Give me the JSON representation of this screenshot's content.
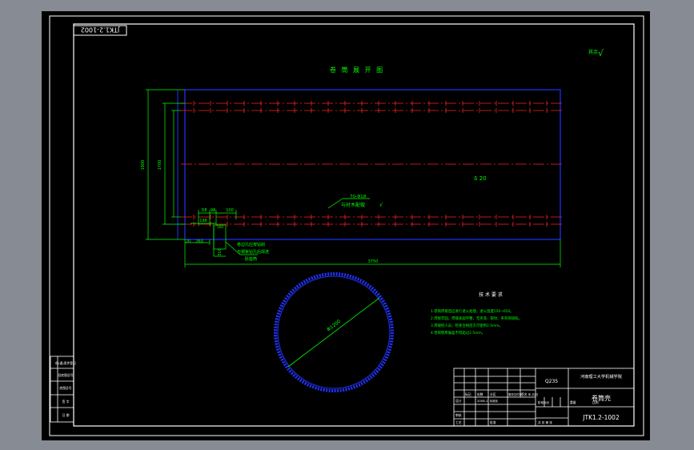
{
  "drawing": {
    "code_box": "JTK1.2-1002",
    "title": "卷 筒 展 开 图",
    "roughness": "其余",
    "roughness_symbol": "√"
  },
  "dimensions": {
    "total_height": "1900",
    "inner_height": "1700",
    "total_length": "3750",
    "offset_196": "196",
    "dim_d8": "D8",
    "dim_98": "98",
    "dim_100": "100",
    "dim_160": "160",
    "dim_260": "260",
    "dim_20": "20",
    "dim_310": "310",
    "thickness": "δ 20",
    "diameter": "Φ1200"
  },
  "annotations": {
    "weld_top": "70-Φ18",
    "weld_bottom": "与衬木配做",
    "hole_note_1": "卷边孔应按钻削",
    "hole_note_2": "与钢板钻孔后焊连",
    "hole_note_3": "卧座筒"
  },
  "tech_req": {
    "title": "技 术 要 求",
    "items": [
      "1.卷筒焊接后应进行退火处理，退火温度550~650。",
      "2.焊接牢固，焊缝表面平整，无夹渣、裂纹、夹杂等缺陷。",
      "3.焊缝经人员，检查合格后方可使用2.5mm。",
      "4.卷筒壁厚偏差不得超过2.5mm。"
    ]
  },
  "title_block": {
    "material": "Q235",
    "school": "河南理工大学机械学院",
    "part_name": "卷筒壳",
    "drawing_no": "JTK1.2-1002",
    "header_cells": [
      "标记",
      "处数",
      "分区",
      "更改文件号",
      "签名",
      "年.月.日"
    ],
    "design_label": "设计",
    "design_date": "2008.1",
    "standard_label": "标准化",
    "review_label": "审核",
    "process_label": "工艺",
    "approve_label": "批准",
    "stage_label": "阶段标记",
    "weight_label": "重量",
    "scale_label": "比例",
    "sheets_label": "共 张 第 张"
  },
  "side_panel": {
    "rows": [
      "借(通)用件登记",
      "旧底图总号",
      "底图总号",
      "签 字",
      "日 期"
    ]
  }
}
